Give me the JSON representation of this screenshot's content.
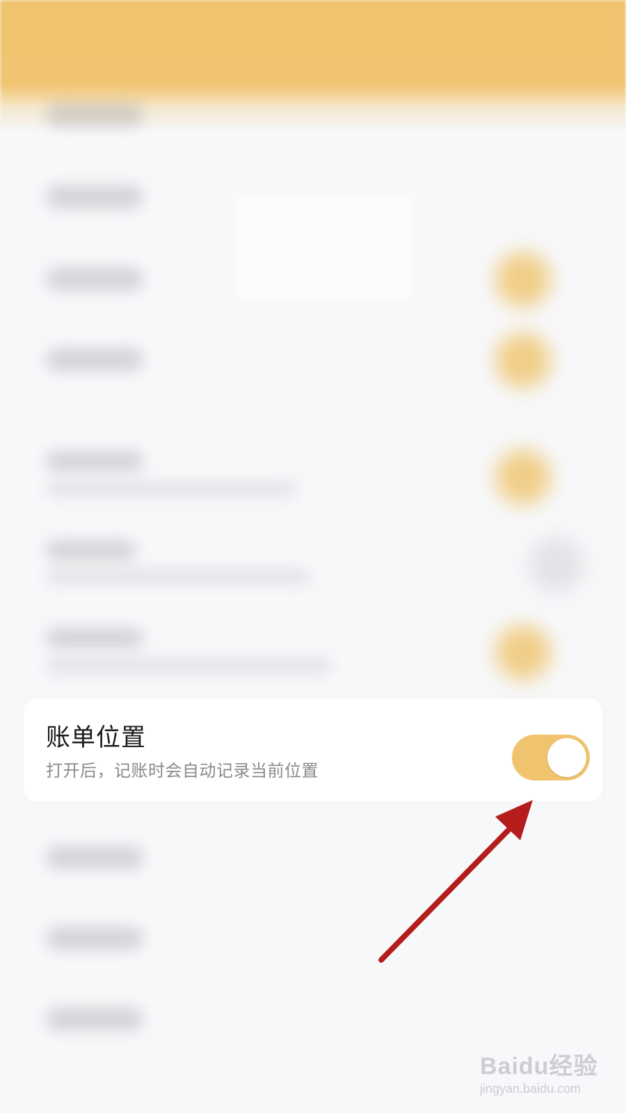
{
  "setting": {
    "title": "账单位置",
    "description": "打开后，记账时会自动记录当前位置",
    "enabled": true
  },
  "watermark": {
    "brand": "Baidu经验",
    "url": "jingyan.baidu.com"
  },
  "colors": {
    "accent": "#f0c46e",
    "header": "#f0c470",
    "arrow": "#b51c1c"
  },
  "icons": {
    "annotation": "red-arrow-icon"
  }
}
